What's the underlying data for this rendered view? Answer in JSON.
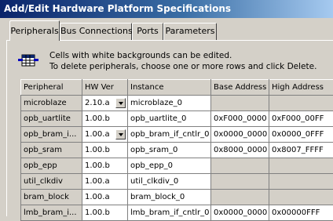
{
  "window": {
    "title": "Add/Edit Hardware Platform Specifications"
  },
  "tabs": [
    {
      "label": "Peripherals",
      "active": true
    },
    {
      "label": "Bus Connections",
      "active": false
    },
    {
      "label": "Ports",
      "active": false
    },
    {
      "label": "Parameters",
      "active": false
    }
  ],
  "info": {
    "line1": "Cells with white backgrounds can be edited.",
    "line2": "To delete peripherals, choose one or more rows and click Delete.",
    "icon": "table-icon"
  },
  "table": {
    "columns": [
      "Peripheral",
      "HW Ver",
      "Instance",
      "Base Address",
      "High Address"
    ],
    "rows": [
      {
        "peripheral": "microblaze",
        "hw_ver": "2.10.a",
        "instance": "microblaze_0",
        "base": "",
        "high": "",
        "dropdown": true
      },
      {
        "peripheral": "opb_uartlite",
        "hw_ver": "1.00.b",
        "instance": "opb_uartlite_0",
        "base": "0xF000_0000",
        "high": "0xF000_00FF",
        "dropdown": false
      },
      {
        "peripheral": "opb_bram_i...",
        "hw_ver": "1.00.a",
        "instance": "opb_bram_if_cntlr_0",
        "base": "0x0000_0000",
        "high": "0x0000_0FFF",
        "dropdown": true
      },
      {
        "peripheral": "opb_sram",
        "hw_ver": "1.00.b",
        "instance": "opb_sram_0",
        "base": "0x8000_0000",
        "high": "0x8007_FFFF",
        "dropdown": false
      },
      {
        "peripheral": "opb_epp",
        "hw_ver": "1.00.b",
        "instance": "opb_epp_0",
        "base": "",
        "high": "",
        "dropdown": false
      },
      {
        "peripheral": "util_clkdiv",
        "hw_ver": "1.00.a",
        "instance": "util_clkdiv_0",
        "base": "",
        "high": "",
        "dropdown": false
      },
      {
        "peripheral": "bram_block",
        "hw_ver": "1.00.a",
        "instance": "bram_block_0",
        "base": "",
        "high": "",
        "dropdown": false
      },
      {
        "peripheral": "lmb_bram_i...",
        "hw_ver": "1.00.b",
        "instance": "lmb_bram_if_cntlr_0",
        "base": "0x0000_0000",
        "high": "0x00000FFF",
        "dropdown": false
      }
    ]
  }
}
